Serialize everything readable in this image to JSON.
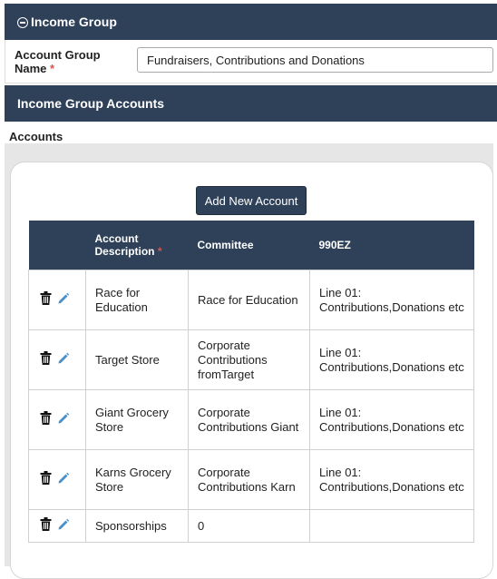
{
  "income_group": {
    "header": "Income Group",
    "name_label": "Account Group Name",
    "required_mark": "*",
    "name_value": "Fundraisers, Contributions and Donations"
  },
  "accounts_section": {
    "header": "Income Group Accounts",
    "title": "Accounts",
    "add_button": "Add New Account"
  },
  "table": {
    "columns": [
      "Account Description",
      "Committee",
      "990EZ"
    ],
    "rows": [
      {
        "description": "Race for Education",
        "committee": "Race for Education",
        "form990ez": "Line 01: Contributions,Donations etc"
      },
      {
        "description": "Target Store",
        "committee": "Corporate Contributions fromTarget",
        "form990ez": "Line 01: Contributions,Donations etc"
      },
      {
        "description": "Giant Grocery Store",
        "committee": "Corporate Contributions Giant",
        "form990ez": "Line 01: Contributions,Donations etc"
      },
      {
        "description": "Karns Grocery Store",
        "committee": "Corporate Contributions Karn",
        "form990ez": "Line 01: Contributions,Donations etc"
      },
      {
        "description": "Sponsorships",
        "committee": "0",
        "form990ez": ""
      }
    ]
  },
  "icons": {
    "collapse": "minus-circle-icon",
    "delete": "trash-icon",
    "edit": "pencil-icon"
  },
  "colors": {
    "header_bg": "#2f4159",
    "required": "#d9534f",
    "edit_icon": "#4a90c8"
  }
}
